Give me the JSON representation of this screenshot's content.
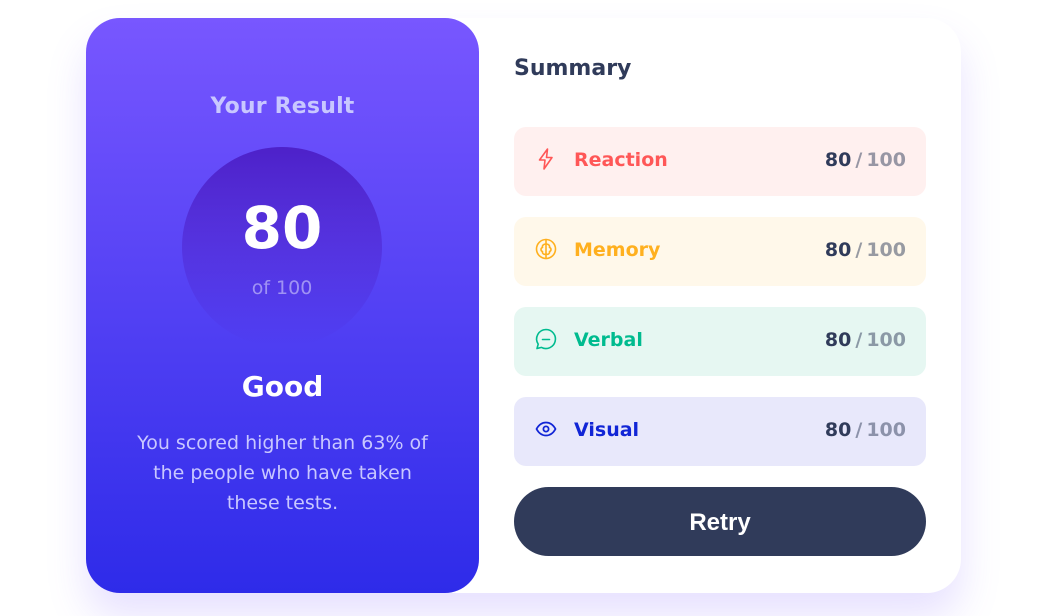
{
  "result": {
    "heading": "Your Result",
    "score": "80",
    "of_text": "of 100",
    "rating": "Good",
    "description": "You scored higher than 63% of the people who have taken these tests."
  },
  "summary": {
    "title": "Summary",
    "items": [
      {
        "label": "Reaction",
        "score": "80",
        "separator": "/",
        "total": "100",
        "icon": "lightning-icon",
        "color": "#ff5757",
        "background": "#fff0ef"
      },
      {
        "label": "Memory",
        "score": "80",
        "separator": "/",
        "total": "100",
        "icon": "brain-icon",
        "color": "#ffb01f",
        "background": "#fff8ea"
      },
      {
        "label": "Verbal",
        "score": "80",
        "separator": "/",
        "total": "100",
        "icon": "chat-bubble-icon",
        "color": "#00bb8f",
        "background": "#e6f7f2"
      },
      {
        "label": "Visual",
        "score": "80",
        "separator": "/",
        "total": "100",
        "icon": "eye-icon",
        "color": "#1125d6",
        "background": "#e8e8fb"
      }
    ]
  },
  "retry_label": "Retry",
  "colors": {
    "gradient_top": "#7857ff",
    "gradient_bottom": "#2e2be9",
    "dark_navy": "#303b5a"
  }
}
